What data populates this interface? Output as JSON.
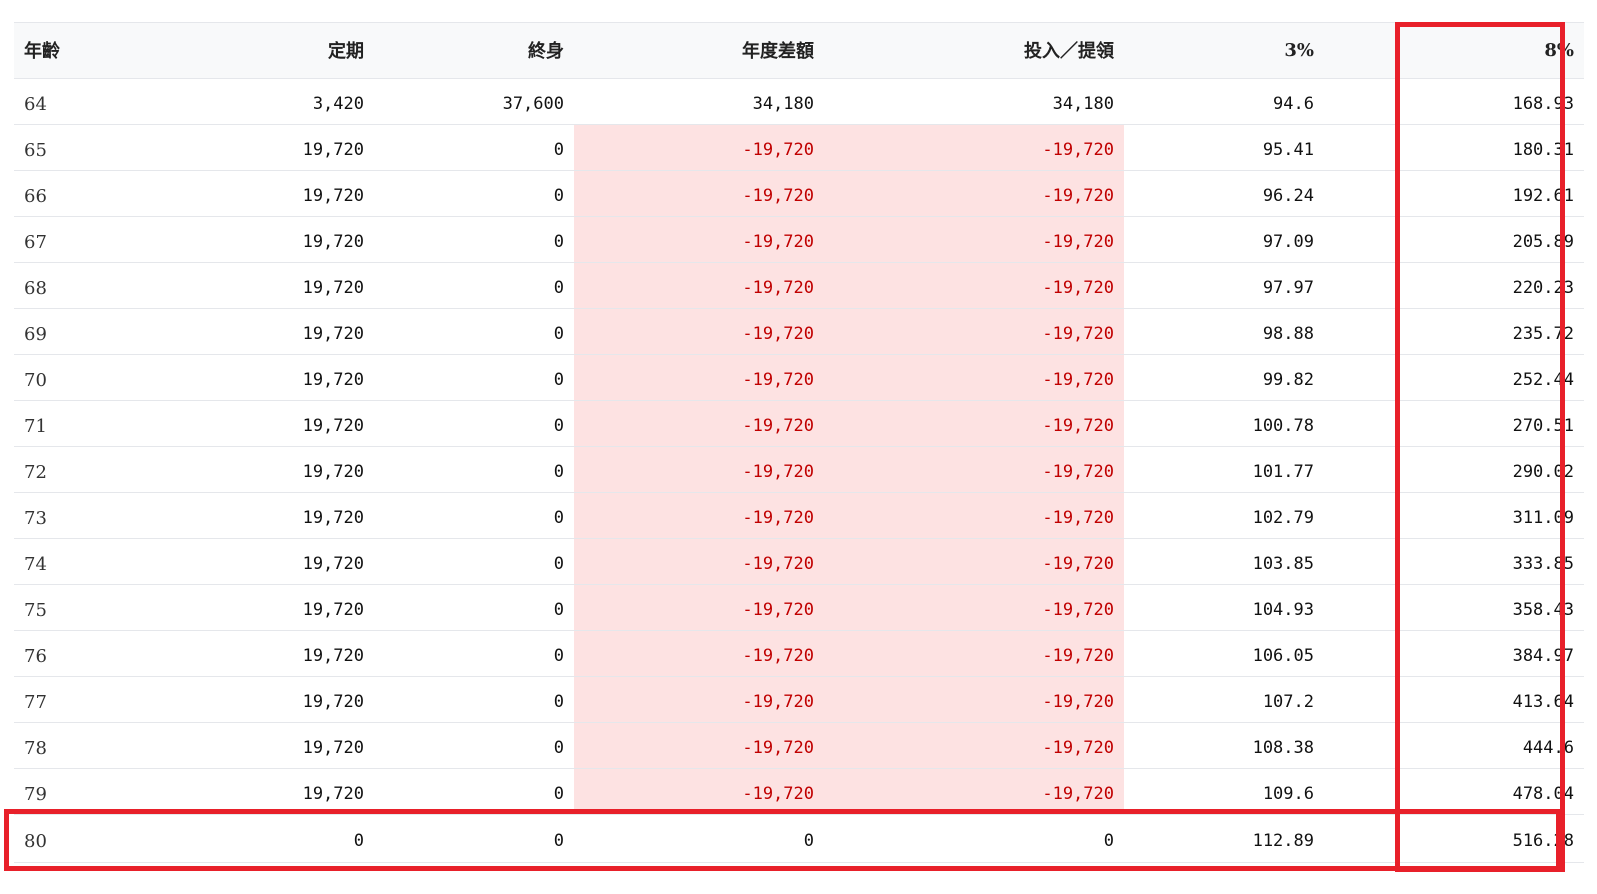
{
  "table": {
    "headers": [
      "年齡",
      "定期",
      "終身",
      "年度差額",
      "投入／提領",
      "3%",
      "8%"
    ],
    "rows": [
      [
        "64",
        "3,420",
        "37,600",
        "34,180",
        "34,180",
        "94.6",
        "168.93"
      ],
      [
        "65",
        "19,720",
        "0",
        "-19,720",
        "-19,720",
        "95.41",
        "180.31"
      ],
      [
        "66",
        "19,720",
        "0",
        "-19,720",
        "-19,720",
        "96.24",
        "192.61"
      ],
      [
        "67",
        "19,720",
        "0",
        "-19,720",
        "-19,720",
        "97.09",
        "205.89"
      ],
      [
        "68",
        "19,720",
        "0",
        "-19,720",
        "-19,720",
        "97.97",
        "220.23"
      ],
      [
        "69",
        "19,720",
        "0",
        "-19,720",
        "-19,720",
        "98.88",
        "235.72"
      ],
      [
        "70",
        "19,720",
        "0",
        "-19,720",
        "-19,720",
        "99.82",
        "252.44"
      ],
      [
        "71",
        "19,720",
        "0",
        "-19,720",
        "-19,720",
        "100.78",
        "270.51"
      ],
      [
        "72",
        "19,720",
        "0",
        "-19,720",
        "-19,720",
        "101.77",
        "290.02"
      ],
      [
        "73",
        "19,720",
        "0",
        "-19,720",
        "-19,720",
        "102.79",
        "311.09"
      ],
      [
        "74",
        "19,720",
        "0",
        "-19,720",
        "-19,720",
        "103.85",
        "333.85"
      ],
      [
        "75",
        "19,720",
        "0",
        "-19,720",
        "-19,720",
        "104.93",
        "358.43"
      ],
      [
        "76",
        "19,720",
        "0",
        "-19,720",
        "-19,720",
        "106.05",
        "384.97"
      ],
      [
        "77",
        "19,720",
        "0",
        "-19,720",
        "-19,720",
        "107.2",
        "413.64"
      ],
      [
        "78",
        "19,720",
        "0",
        "-19,720",
        "-19,720",
        "108.38",
        "444.6"
      ],
      [
        "79",
        "19,720",
        "0",
        "-19,720",
        "-19,720",
        "109.6",
        "478.04"
      ],
      [
        "80",
        "0",
        "0",
        "0",
        "0",
        "112.89",
        "516.28"
      ]
    ]
  },
  "colors": {
    "highlight_border": "#e8202a",
    "negative_bg": "#fde2e2",
    "negative_text": "#c00000",
    "header_bg": "#f8f9fa"
  }
}
